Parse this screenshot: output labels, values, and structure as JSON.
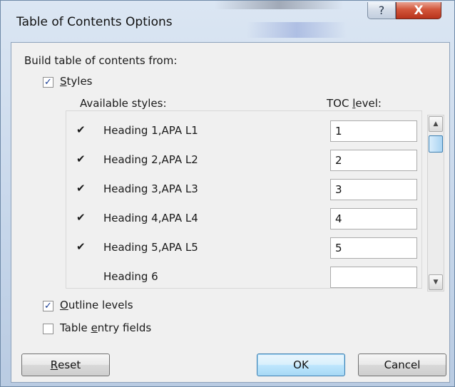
{
  "window": {
    "title": "Table of Contents Options",
    "help_glyph": "?",
    "close_glyph": "X"
  },
  "build": {
    "label": "Build table of contents from:",
    "styles": {
      "label": "Styles",
      "mnemonic": "S",
      "rest": "tyles",
      "checked": true
    },
    "available_header": "Available styles:",
    "toc_header": {
      "prefix": "TOC ",
      "mnemonic": "l",
      "suffix": "evel:"
    },
    "rows": [
      {
        "style": "Heading 1,APA L1",
        "level": "1",
        "checked": true
      },
      {
        "style": "Heading 2,APA L2",
        "level": "2",
        "checked": true
      },
      {
        "style": "Heading 3,APA L3",
        "level": "3",
        "checked": true
      },
      {
        "style": "Heading 4,APA L4",
        "level": "4",
        "checked": true
      },
      {
        "style": "Heading 5,APA L5",
        "level": "5",
        "checked": true
      },
      {
        "style": "Heading 6",
        "level": "",
        "checked": false
      }
    ],
    "outline": {
      "mnemonic": "O",
      "rest": "utline levels",
      "checked": true
    },
    "table_entry": {
      "prefix": "Table ",
      "mnemonic": "e",
      "suffix": "ntry fields",
      "checked": false
    }
  },
  "buttons": {
    "reset": {
      "mnemonic": "R",
      "rest": "eset"
    },
    "ok": "OK",
    "cancel": "Cancel"
  },
  "icons": {
    "check_glyph": "✓",
    "row_check_glyph": "✔",
    "scroll_up": "▲",
    "scroll_down": "▼"
  },
  "colors": {
    "close_red": "#d2563b",
    "default_button": "#bee6fd",
    "checkbox_mark": "#1c3f94"
  }
}
